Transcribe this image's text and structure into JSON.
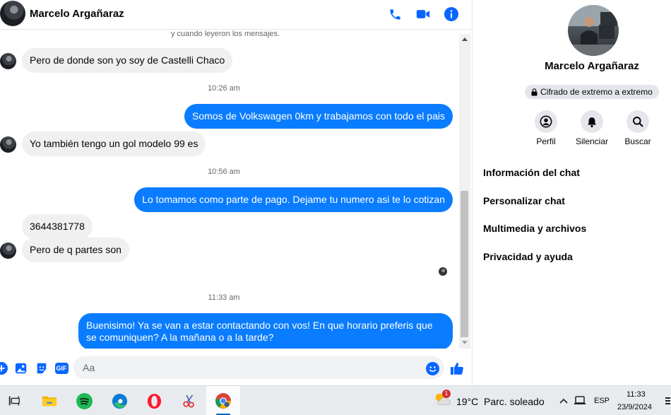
{
  "chat": {
    "contact_name": "Marcelo Argañaraz",
    "faded_note": "y cuando leyeron los mensajes.",
    "messages": [
      {
        "text": "Pero de donde son yo soy de Castelli Chaco"
      },
      {
        "time": "10:26 am"
      },
      {
        "text": "Somos de Volkswagen 0km y trabajamos con todo el pais"
      },
      {
        "text": "Yo también tengo un gol modelo 99 es"
      },
      {
        "time": "10:56 am"
      },
      {
        "text": "Lo tomamos como parte de pago. Dejame tu numero asi te lo cotizan"
      },
      {
        "text": "3644381778"
      },
      {
        "text": "Pero de q partes son"
      },
      {
        "time": "11:33 am"
      },
      {
        "text": "Buenisimo! Ya se van a estar contactando con vos! En que horario preferis que se comuniquen? A la mañana o a la tarde?"
      }
    ],
    "composer": {
      "placeholder": "Aa",
      "gif_label": "GIF"
    }
  },
  "details": {
    "name": "Marcelo Argañaraz",
    "encryption_badge": "Cifrado de extremo a extremo",
    "actions": [
      {
        "label": "Perfil",
        "icon": "profile-icon"
      },
      {
        "label": "Silenciar",
        "icon": "bell-icon"
      },
      {
        "label": "Buscar",
        "icon": "search-icon"
      }
    ],
    "menu": [
      "Información del chat",
      "Personalizar chat",
      "Multimedia y archivos",
      "Privacidad y ayuda"
    ]
  },
  "taskbar": {
    "weather_temp": "19°C",
    "weather_condition": "Parc. soleado",
    "weather_badge": "1",
    "language": "ESP",
    "time": "11:33",
    "date": "23/9/2024"
  },
  "colors": {
    "messenger_blue": "#0a7cff",
    "icon_blue": "#0866ff",
    "incoming_bubble": "#f0f0f0",
    "taskbar": "#e8ebee"
  }
}
